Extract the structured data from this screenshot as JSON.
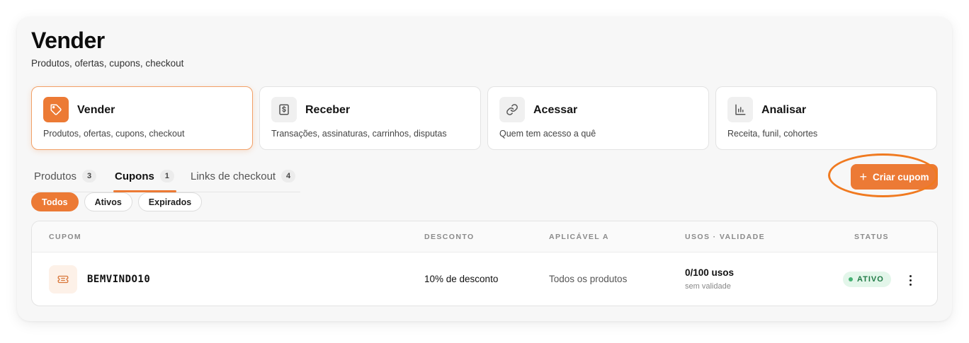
{
  "page": {
    "title": "Vender",
    "subtitle": "Produtos, ofertas, cupons, checkout"
  },
  "cards": [
    {
      "title": "Vender",
      "desc": "Produtos, ofertas, cupons, checkout",
      "icon": "tag-icon",
      "active": true
    },
    {
      "title": "Receber",
      "desc": "Transações, assinaturas, carrinhos, disputas",
      "icon": "dollar-receipt-icon",
      "active": false
    },
    {
      "title": "Acessar",
      "desc": "Quem tem acesso a quê",
      "icon": "link-icon",
      "active": false
    },
    {
      "title": "Analisar",
      "desc": "Receita, funil, cohortes",
      "icon": "bar-chart-icon",
      "active": false
    }
  ],
  "tabs": [
    {
      "label": "Produtos",
      "count": "3"
    },
    {
      "label": "Cupons",
      "count": "1",
      "active": true
    },
    {
      "label": "Links de checkout",
      "count": "4"
    }
  ],
  "actions": {
    "create_label": "Criar cupom",
    "create_icon": "plus-icon"
  },
  "filters": [
    {
      "label": "Todos",
      "active": true
    },
    {
      "label": "Ativos"
    },
    {
      "label": "Expirados"
    }
  ],
  "table": {
    "headers": [
      "CUPOM",
      "DESCONTO",
      "APLICÁVEL A",
      "USOS · VALIDADE",
      "STATUS"
    ],
    "rows": [
      {
        "code": "BEMVINDO10",
        "discount": "10% de desconto",
        "applies_to": "Todos os produtos",
        "uses": "0/100 usos",
        "validity": "sem validade",
        "status": "ATIVO"
      }
    ]
  },
  "colors": {
    "accent": "#ec7a35",
    "status_active_bg": "#e3f6ea",
    "status_active_text": "#1f7a45"
  }
}
